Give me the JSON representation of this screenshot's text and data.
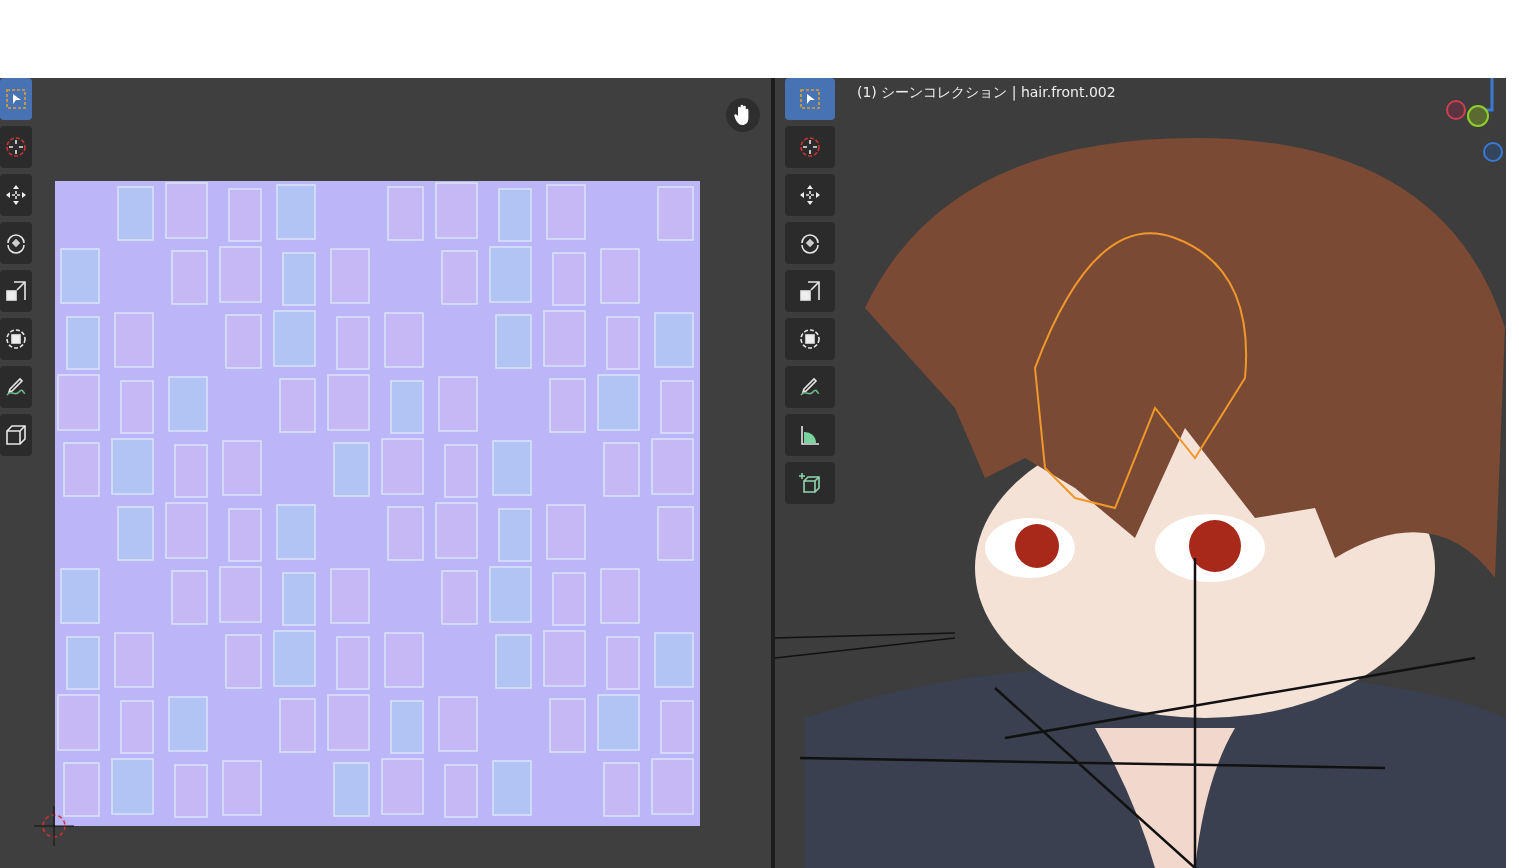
{
  "uv_editor": {
    "tools": [
      {
        "kind": "select",
        "selected": true
      },
      {
        "kind": "cursor",
        "selected": false
      },
      {
        "kind": "move",
        "selected": false
      },
      {
        "kind": "rotate",
        "selected": false
      },
      {
        "kind": "scale",
        "selected": false
      },
      {
        "kind": "transform",
        "selected": false
      },
      {
        "kind": "annotate",
        "selected": false
      },
      {
        "kind": "cube",
        "selected": false
      }
    ]
  },
  "viewport": {
    "header": "(1) シーンコレクション | hair.front.002",
    "tools": [
      {
        "kind": "select",
        "selected": true
      },
      {
        "kind": "cursor",
        "selected": false
      },
      {
        "kind": "move",
        "selected": false
      },
      {
        "kind": "rotate",
        "selected": false
      },
      {
        "kind": "scale",
        "selected": false
      },
      {
        "kind": "transform",
        "selected": false
      },
      {
        "kind": "annotate",
        "selected": false
      },
      {
        "kind": "measure",
        "selected": false
      },
      {
        "kind": "addcube",
        "selected": false
      }
    ]
  }
}
